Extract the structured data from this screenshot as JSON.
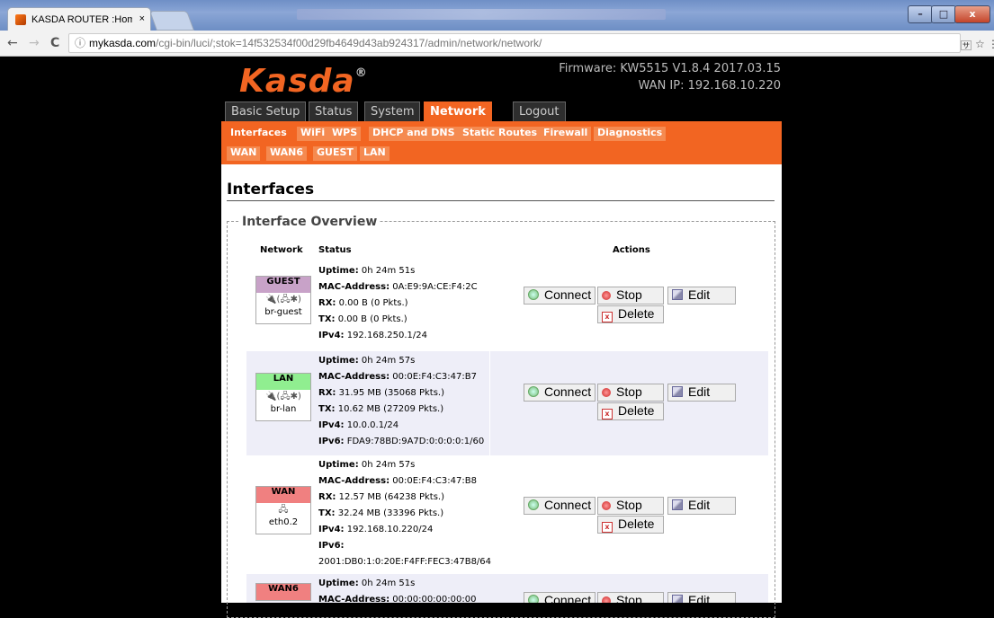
{
  "browser": {
    "tab_title": "KASDA ROUTER :Home",
    "tab_close": "×",
    "url_host": "mykasda.com",
    "url_path": "/cgi-bin/luci/;stok=14f532534f00d29fb4649d43ab924317/admin/network/network/",
    "back": "←",
    "forward": "→",
    "reload": "C",
    "info": "ⓘ",
    "translate": "🈂",
    "star": "☆",
    "menu": "⋮"
  },
  "header": {
    "logo": "Kasda",
    "logo_mark": "®",
    "firmware": "Firmware: KW5515 V1.8.4 2017.03.15",
    "wan_ip": "WAN IP: 192.168.10.220"
  },
  "main_tabs": [
    "Basic Setup",
    "Status",
    "System",
    "Network",
    "Logout"
  ],
  "sub_tabs": [
    "Interfaces",
    "WiFi",
    "WPS",
    "DHCP and DNS",
    "Static Routes",
    "Firewall",
    "Diagnostics"
  ],
  "iface_tabs": [
    "WAN",
    "WAN6",
    "GUEST",
    "LAN"
  ],
  "page_title": "Interfaces",
  "section_title": "Interface Overview",
  "columns": {
    "network": "Network",
    "status": "Status",
    "actions": "Actions"
  },
  "buttons": {
    "connect": "Connect",
    "stop": "Stop",
    "edit": "Edit",
    "delete": "Delete"
  },
  "colors": {
    "accent": "#f26522",
    "guest": "#c8a2c8",
    "lan": "#90ee90",
    "wan": "#f08080",
    "wan6": "#f08080"
  },
  "interfaces": [
    {
      "name": "GUEST",
      "icons": "🔌(🖧✱)",
      "device": "br-guest",
      "lines": [
        {
          "k": "Uptime:",
          "v": " 0h 24m 51s"
        },
        {
          "k": "MAC-Address:",
          "v": " 0A:E9:9A:CE:F4:2C"
        },
        {
          "k": "RX:",
          "v": " 0.00 B (0 Pkts.)"
        },
        {
          "k": "TX:",
          "v": " 0.00 B (0 Pkts.)"
        },
        {
          "k": "IPv4:",
          "v": " 192.168.250.1/24"
        }
      ]
    },
    {
      "name": "LAN",
      "icons": "🔌(🖧✱)",
      "device": "br-lan",
      "lines": [
        {
          "k": "Uptime:",
          "v": " 0h 24m 57s"
        },
        {
          "k": "MAC-Address:",
          "v": " 00:0E:F4:C3:47:B7"
        },
        {
          "k": "RX:",
          "v": " 31.95 MB (35068 Pkts.)"
        },
        {
          "k": "TX:",
          "v": " 10.62 MB (27209 Pkts.)"
        },
        {
          "k": "IPv4:",
          "v": " 10.0.0.1/24"
        },
        {
          "k": "IPv6:",
          "v": " FDA9:78BD:9A7D:0:0:0:0:1/60"
        }
      ]
    },
    {
      "name": "WAN",
      "icons": "🖧",
      "device": "eth0.2",
      "lines": [
        {
          "k": "Uptime:",
          "v": " 0h 24m 57s"
        },
        {
          "k": "MAC-Address:",
          "v": " 00:0E:F4:C3:47:B8"
        },
        {
          "k": "RX:",
          "v": " 12.57 MB (64238 Pkts.)"
        },
        {
          "k": "TX:",
          "v": " 32.24 MB (33396 Pkts.)"
        },
        {
          "k": "IPv4:",
          "v": " 192.168.10.220/24"
        },
        {
          "k": "IPv6:",
          "v": ""
        },
        {
          "k": "",
          "v": "2001:DB0:1:0:20E:F4FF:FEC3:47B8/64"
        }
      ]
    },
    {
      "name": "WAN6",
      "icons": "",
      "device": "",
      "lines": [
        {
          "k": "Uptime:",
          "v": " 0h 24m 51s"
        },
        {
          "k": "MAC-Address:",
          "v": " 00:00:00:00:00:00"
        }
      ]
    }
  ]
}
